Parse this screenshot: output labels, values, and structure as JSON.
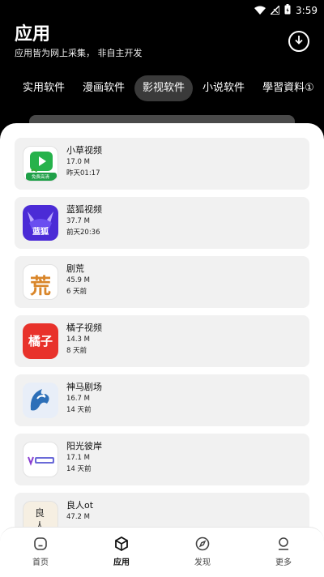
{
  "status": {
    "time": "3:59"
  },
  "header": {
    "title": "应用",
    "subtitle": "应用皆为网上采集， 非自主开发",
    "download_icon": "download-icon"
  },
  "tabs": [
    {
      "label": "实用软件"
    },
    {
      "label": "漫画软件"
    },
    {
      "label": "影视软件"
    },
    {
      "label": "小说软件"
    },
    {
      "label": "學習資料①"
    },
    {
      "label": "學"
    }
  ],
  "active_tab": "影视软件",
  "apps": [
    {
      "name": "小草视频",
      "size": "17.0 M",
      "time": "昨天01:17",
      "icon": "xiaocao-video-icon",
      "icon_text": "免费高清"
    },
    {
      "name": "蓝狐视频",
      "size": "37.7 M",
      "time": "前天20:36",
      "icon": "lanhu-video-icon",
      "icon_text": "蓝狐"
    },
    {
      "name": "剧荒",
      "size": "45.9 M",
      "time": "6 天前",
      "icon": "juhuang-icon",
      "icon_text": "荒"
    },
    {
      "name": "橘子视频",
      "size": "14.3 M",
      "time": "8 天前",
      "icon": "juzi-video-icon",
      "icon_text": "橘子"
    },
    {
      "name": "神马剧场",
      "size": "16.7 M",
      "time": "14 天前",
      "icon": "shenma-theater-icon",
      "icon_text": ""
    },
    {
      "name": "阳光彼岸",
      "size": "17.1 M",
      "time": "14 天前",
      "icon": "yangguang-biyan-icon",
      "icon_text": ""
    },
    {
      "name": "良人ot",
      "size": "47.2 M",
      "time": "",
      "icon": "liangren-icon",
      "icon_text": "良人"
    }
  ],
  "nav": [
    {
      "label": "首页",
      "icon": "home-icon"
    },
    {
      "label": "应用",
      "icon": "apps-cube-icon"
    },
    {
      "label": "发现",
      "icon": "compass-icon"
    },
    {
      "label": "更多",
      "icon": "person-icon"
    }
  ],
  "active_nav": "应用",
  "colors": {
    "background": "#000000",
    "card": "#f1f1f1",
    "active_tab_bg": "#3a3a3a",
    "xiaocao_green": "#26b24b",
    "lanhu_purple": "#4b2bd6",
    "juhuang_orange": "#d9862a",
    "juzi_red": "#e8322b",
    "shenma_blue": "#2d6fb8"
  }
}
